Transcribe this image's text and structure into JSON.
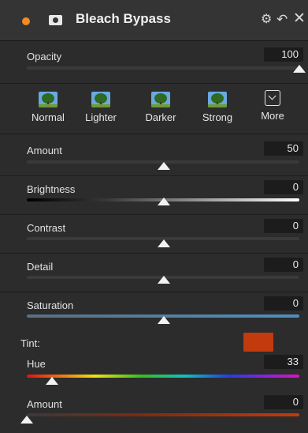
{
  "header": {
    "title": "Bleach Bypass",
    "power_icon": "power-dot-icon",
    "mask_icon": "mask-icon",
    "gear_glyph": "⚙",
    "undo_glyph": "↶",
    "close_glyph": "✕",
    "power_color": "#f28b21"
  },
  "opacity": {
    "label": "Opacity",
    "value": "100",
    "level": 1.0
  },
  "presets": [
    {
      "label": "Normal",
      "icon": "tree-thumbnail-icon"
    },
    {
      "label": "Lighter",
      "icon": "tree-thumbnail-icon"
    },
    {
      "label": "Darker",
      "icon": "tree-thumbnail-icon"
    },
    {
      "label": "Strong",
      "icon": "tree-thumbnail-icon"
    },
    {
      "label": "More",
      "icon": "chevron-down-box-icon"
    }
  ],
  "sliders": [
    {
      "label": "Amount",
      "value": "50",
      "level": 0.5
    },
    {
      "label": "Brightness",
      "value": "0",
      "level": 0.5
    },
    {
      "label": "Contrast",
      "value": "0",
      "level": 0.5
    },
    {
      "label": "Detail",
      "value": "0",
      "level": 0.5
    },
    {
      "label": "Saturation",
      "value": "0",
      "level": 0.5
    }
  ],
  "tint": {
    "label": "Tint:",
    "color": "#c23a0d",
    "hue": {
      "label": "Hue",
      "value": "33",
      "level": 0.092
    },
    "amount": {
      "label": "Amount",
      "value": "0",
      "level": 0.0
    }
  }
}
